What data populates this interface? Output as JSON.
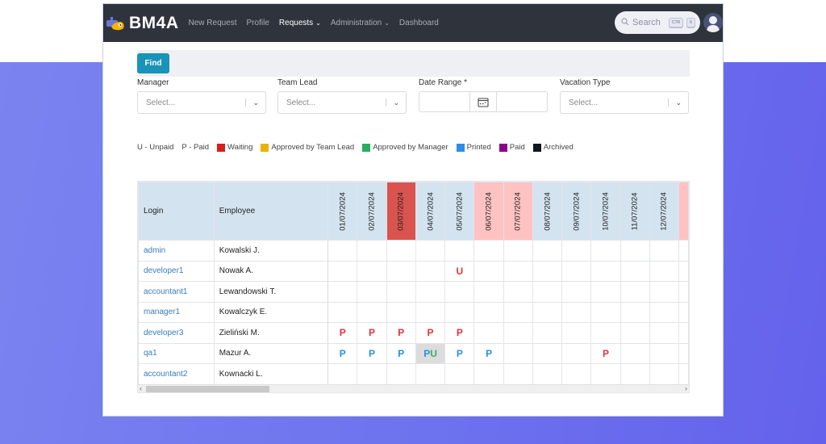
{
  "app": {
    "brand": "BM4A"
  },
  "nav": {
    "items": [
      {
        "label": "New Request",
        "active": false,
        "dropdown": false
      },
      {
        "label": "Profile",
        "active": false,
        "dropdown": false
      },
      {
        "label": "Requests",
        "active": true,
        "dropdown": true
      },
      {
        "label": "Administration",
        "active": false,
        "dropdown": true
      },
      {
        "label": "Dashboard",
        "active": false,
        "dropdown": false
      }
    ],
    "search": {
      "placeholder": "Search",
      "shortcut_keys": [
        "CTR",
        "K"
      ]
    }
  },
  "toolbar": {
    "find_label": "Find"
  },
  "filters": {
    "manager": {
      "label": "Manager",
      "placeholder": "Select..."
    },
    "team_lead": {
      "label": "Team Lead",
      "placeholder": "Select..."
    },
    "date_range": {
      "label": "Date Range *",
      "start": "",
      "end": ""
    },
    "vacation_type": {
      "label": "Vacation Type",
      "placeholder": "Select..."
    }
  },
  "legend": {
    "codes": [
      "U - Unpaid",
      "P - Paid"
    ],
    "statuses": [
      {
        "label": "Waiting",
        "color": "#dc1c1c"
      },
      {
        "label": "Approved by Team Lead",
        "color": "#e9b400"
      },
      {
        "label": "Approved by Manager",
        "color": "#27ae60"
      },
      {
        "label": "Printed",
        "color": "#2a8ee8"
      },
      {
        "label": "Paid",
        "color": "#8b008b"
      },
      {
        "label": "Archived",
        "color": "#0f1720"
      }
    ]
  },
  "table": {
    "headers": {
      "login": "Login",
      "employee": "Employee"
    },
    "dates": [
      {
        "label": "01/07/2024",
        "kind": "normal"
      },
      {
        "label": "02/07/2024",
        "kind": "normal"
      },
      {
        "label": "03/07/2024",
        "kind": "today"
      },
      {
        "label": "04/07/2024",
        "kind": "normal"
      },
      {
        "label": "05/07/2024",
        "kind": "normal"
      },
      {
        "label": "06/07/2024",
        "kind": "weekend"
      },
      {
        "label": "07/07/2024",
        "kind": "weekend"
      },
      {
        "label": "08/07/2024",
        "kind": "normal"
      },
      {
        "label": "09/07/2024",
        "kind": "normal"
      },
      {
        "label": "10/07/2024",
        "kind": "normal"
      },
      {
        "label": "11/07/2024",
        "kind": "normal"
      },
      {
        "label": "12/07/2024",
        "kind": "normal"
      }
    ],
    "rows": [
      {
        "login": "admin",
        "employee": "Kowalski J.",
        "cells": [
          "",
          "",
          "",
          "",
          "",
          "",
          "",
          "",
          "",
          "",
          "",
          ""
        ]
      },
      {
        "login": "developer1",
        "employee": "Nowak A.",
        "cells": [
          "",
          "",
          "",
          "",
          "U:red",
          "",
          "",
          "",
          "",
          "",
          "",
          ""
        ]
      },
      {
        "login": "accountant1",
        "employee": "Lewandowski T.",
        "cells": [
          "",
          "",
          "",
          "",
          "",
          "",
          "",
          "",
          "",
          "",
          "",
          ""
        ]
      },
      {
        "login": "manager1",
        "employee": "Kowalczyk E.",
        "cells": [
          "",
          "",
          "",
          "",
          "",
          "",
          "",
          "",
          "",
          "",
          "",
          ""
        ]
      },
      {
        "login": "developer3",
        "employee": "Zieliński M.",
        "cells": [
          "P:red",
          "P:red",
          "P:red",
          "P:red",
          "P:red",
          "",
          "",
          "",
          "",
          "",
          "",
          ""
        ]
      },
      {
        "login": "qa1",
        "employee": "Mazur A.",
        "cells": [
          "P:blue",
          "P:blue",
          "P:blue",
          "PU",
          "P:blue",
          "P:blue",
          "",
          "",
          "",
          "P:red",
          "",
          ""
        ]
      },
      {
        "login": "accountant2",
        "employee": "Kownacki L.",
        "cells": [
          "",
          "",
          "",
          "",
          "",
          "",
          "",
          "",
          "",
          "",
          "",
          ""
        ]
      }
    ]
  }
}
